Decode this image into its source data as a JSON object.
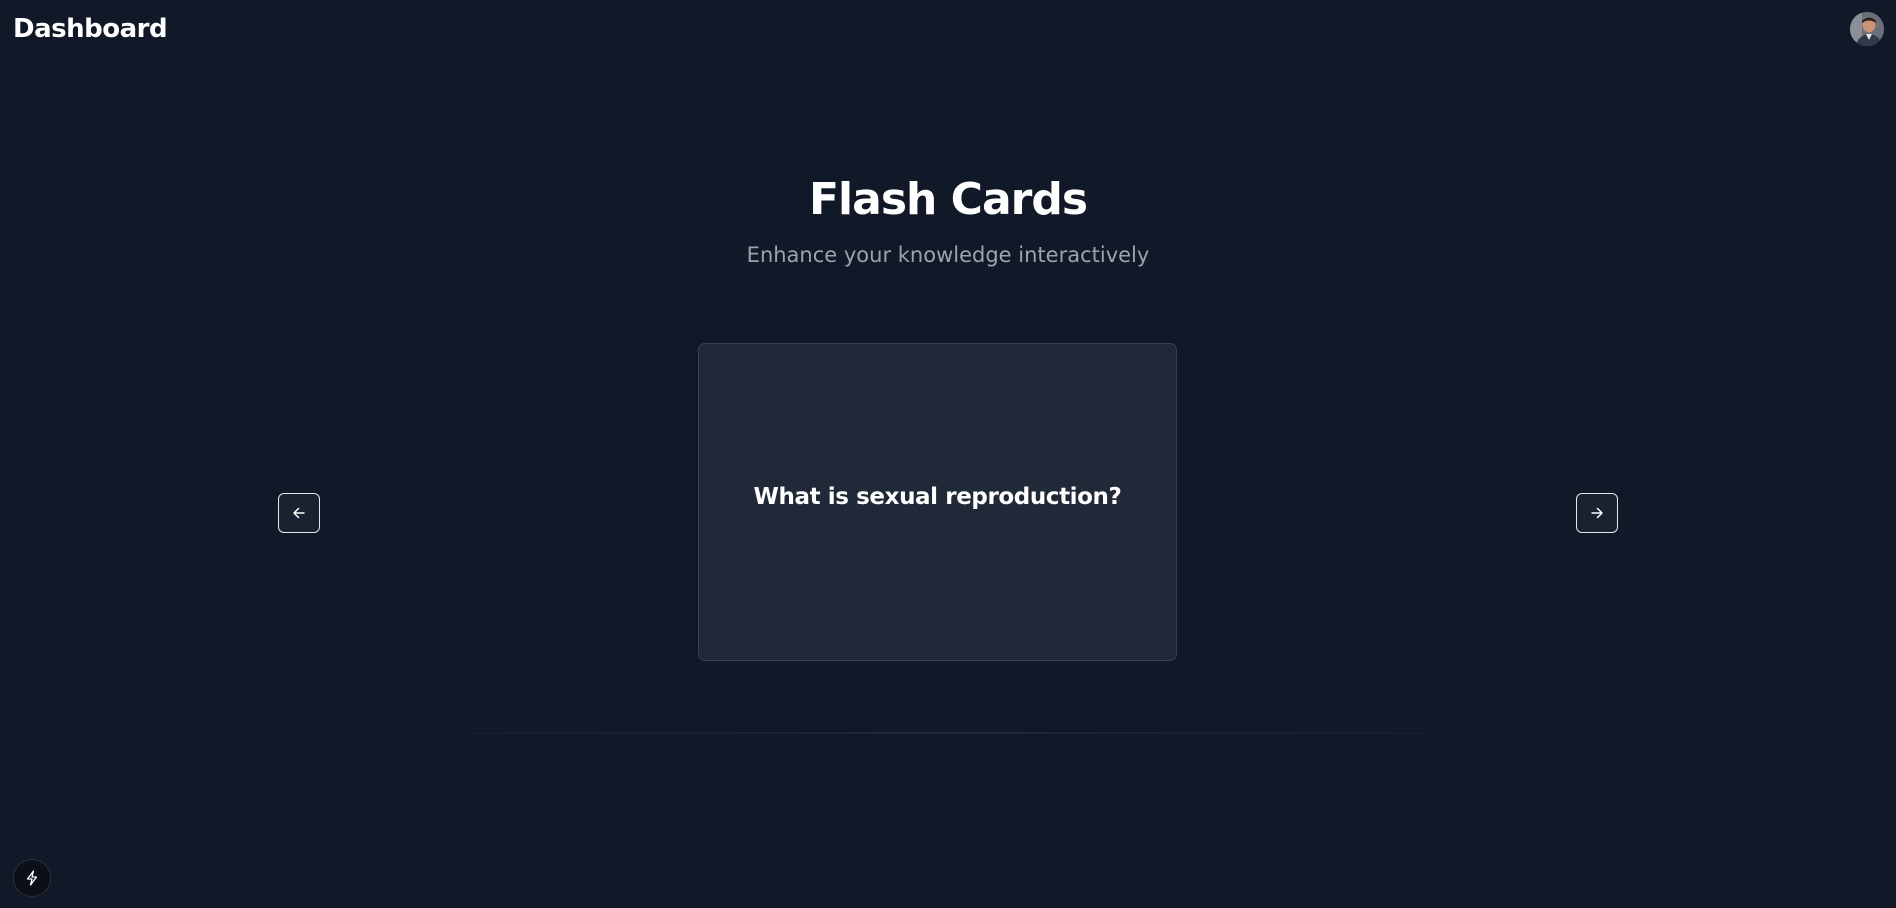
{
  "header": {
    "title": "Dashboard",
    "avatar_icon": "user-avatar"
  },
  "hero": {
    "title": "Flash Cards",
    "subtitle": "Enhance your knowledge interactively"
  },
  "card": {
    "question": "What is sexual reproduction?"
  },
  "navigation": {
    "prev_icon": "arrow-left-icon",
    "next_icon": "arrow-right-icon"
  },
  "floating": {
    "icon": "bolt-icon"
  },
  "colors": {
    "background": "#111827",
    "card_background": "#1f2937",
    "card_border": "#374151",
    "subtitle": "#9ca3af",
    "text": "#ffffff"
  }
}
